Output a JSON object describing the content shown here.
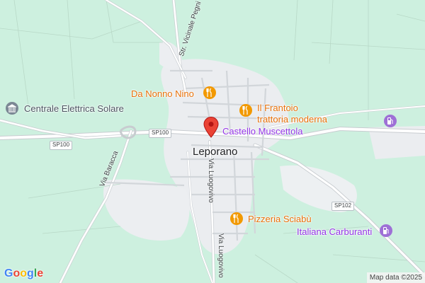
{
  "map": {
    "town_label": "Leporano",
    "pois": [
      {
        "name": "Da Nonno Nino",
        "type": "restaurant",
        "icon": "fork-knife-icon",
        "color": "#e8710a"
      },
      {
        "name": "Il Frantoio",
        "name_line2": "trattoria moderna",
        "type": "restaurant",
        "icon": "fork-knife-icon",
        "color": "#e8710a"
      },
      {
        "name": "Castello Muscettola",
        "type": "landmark",
        "icon": "map-pin-icon",
        "color": "#9334e6"
      },
      {
        "name": "Pizzeria Sciabù",
        "type": "restaurant",
        "icon": "fork-knife-icon",
        "color": "#e8710a"
      },
      {
        "name": "Centrale Elettrica Solare",
        "type": "building",
        "icon": "museum-icon",
        "color": "#5f6368"
      },
      {
        "name": "Italiana Carburanti",
        "type": "gas-station",
        "icon": "fuel-pump-icon",
        "color": "#9334e6"
      }
    ],
    "fuel_icon_upper": "fuel-pump-icon",
    "streets": {
      "vicinale": "Str. Vicinale Pegni",
      "baracca": "Via Baracca",
      "luogovivo": "Via Luogovivo",
      "luogovivo_lower": "Via Luogovivo"
    },
    "road_shields": {
      "sp100_left": "SP100",
      "sp100_center": "SP100",
      "sp102": "SP102"
    },
    "colors": {
      "background_green": "#cdf0df",
      "urban_gray": "#ebedf0",
      "road": "#ffffff",
      "road_outline": "#c8ccd0",
      "pin": "#ea4335"
    },
    "logo": "Google",
    "attribution": "Map data ©2025"
  }
}
